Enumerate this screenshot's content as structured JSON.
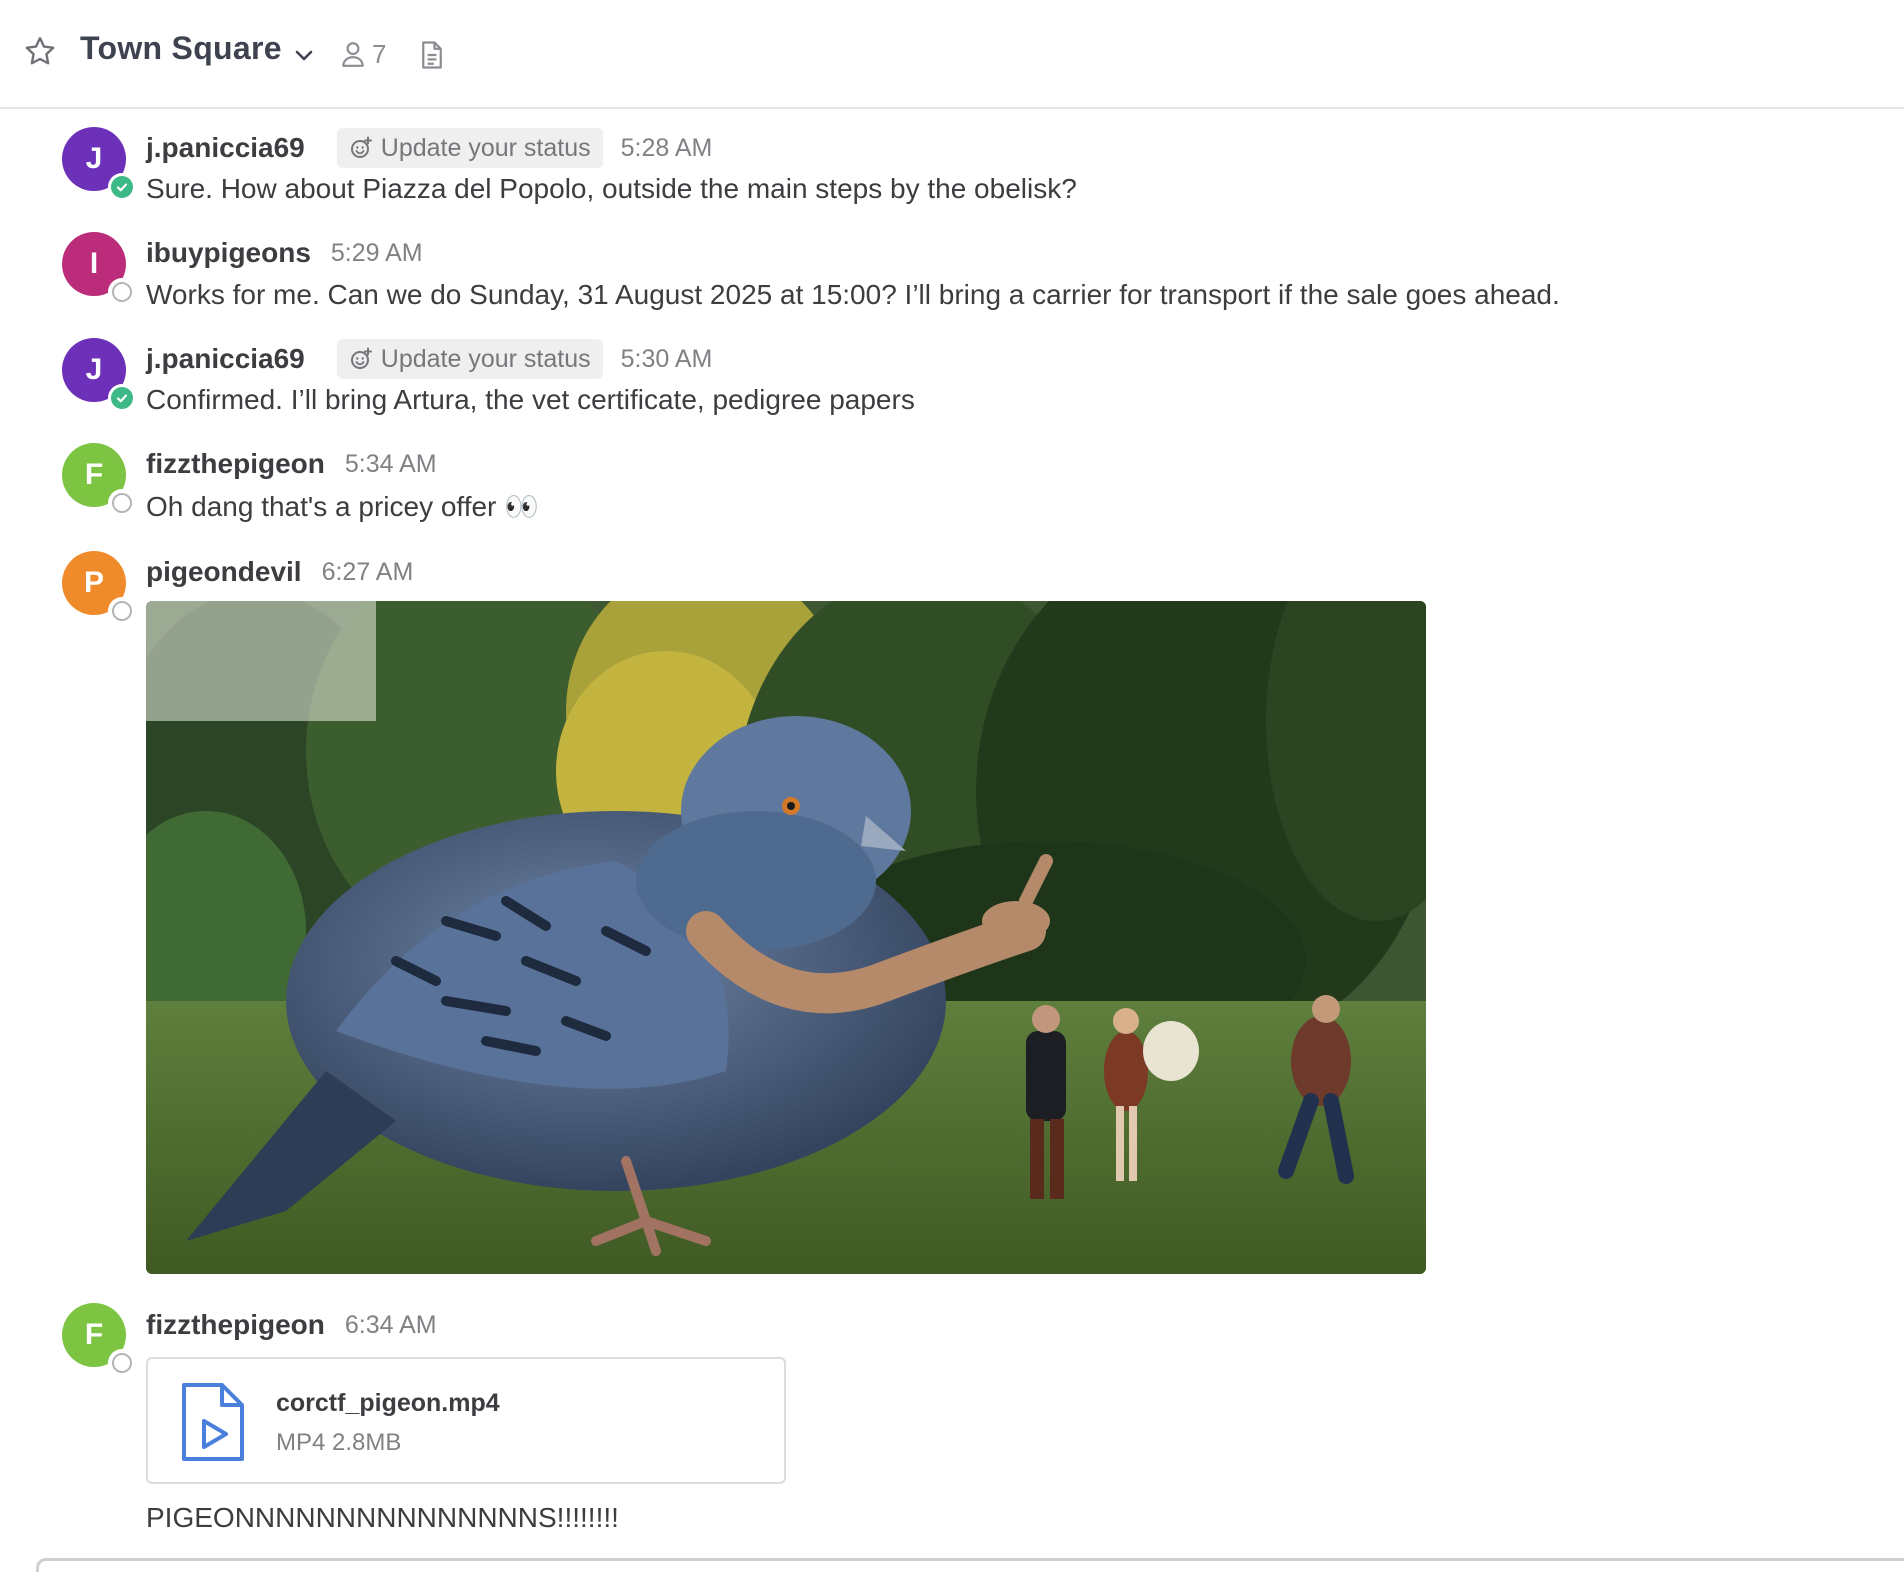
{
  "header": {
    "channel_name": "Town Square",
    "member_count": "7",
    "icons": [
      "star-icon",
      "chevron-down-icon",
      "member-icon",
      "files-icon"
    ]
  },
  "colors": {
    "avatar_j": "#6c30b9",
    "avatar_i": "#bb2d7b",
    "avatar_f": "#7dc443",
    "avatar_p": "#f08b2c",
    "online": "#3db887"
  },
  "messages": [
    {
      "avatar_letter": "J",
      "username": "j.paniccia69",
      "status_label": "Update your status",
      "time": "5:28 AM",
      "text": "Sure. How about Piazza del Popolo, outside the main steps by the obelisk?"
    },
    {
      "avatar_letter": "I",
      "username": "ibuypigeons",
      "time": "5:29 AM",
      "text": "Works for me. Can we do Sunday, 31 August 2025 at 15:00? I’ll bring a carrier for transport if the sale goes ahead."
    },
    {
      "avatar_letter": "J",
      "username": "j.paniccia69",
      "status_label": "Update your status",
      "time": "5:30 AM",
      "text": "Confirmed. I’ll bring Artura, the vet certificate, pedigree papers"
    },
    {
      "avatar_letter": "F",
      "username": "fizzthepigeon",
      "time": "5:34 AM",
      "text": "Oh dang that's a pricey offer 👀"
    },
    {
      "avatar_letter": "P",
      "username": "pigeondevil",
      "time": "6:27 AM"
    },
    {
      "avatar_letter": "F",
      "username": "fizzthepigeon",
      "time": "6:34 AM",
      "text": "PIGEONNNNNNNNNNNNNNNS!!!!!!!!",
      "attachment": {
        "name": "corctf_pigeon.mp4",
        "meta": "MP4 2.8MB"
      }
    }
  ]
}
